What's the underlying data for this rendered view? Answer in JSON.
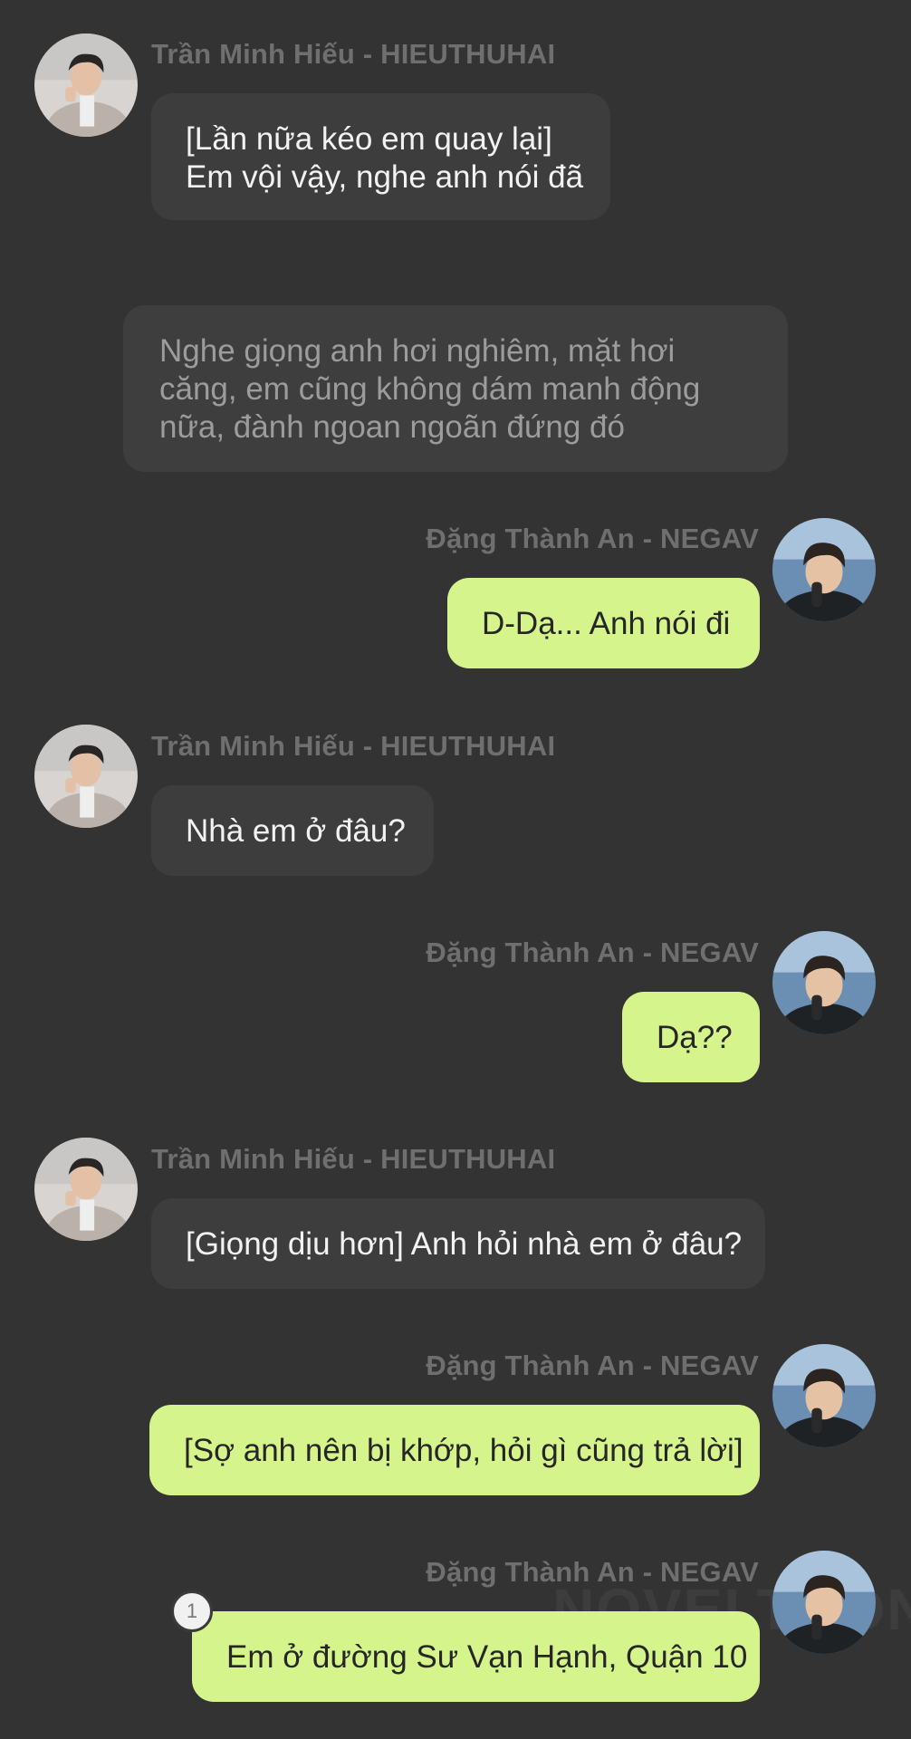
{
  "characters": {
    "left": {
      "name": "Trần Minh Hiếu - HIEUTHUHAI"
    },
    "right": {
      "name": "Đặng Thành An - NEGAV"
    }
  },
  "messages": [
    {
      "side": "left",
      "lines": [
        "[Lần nữa kéo em quay lại]",
        "Em vội vậy, nghe anh nói đã"
      ]
    },
    {
      "side": "narration",
      "lines": [
        "Nghe giọng anh hơi nghiêm, mặt hơi",
        "căng, em cũng không dám manh động",
        "nữa, đành ngoan ngoãn đứng đó"
      ]
    },
    {
      "side": "right",
      "lines": [
        "D-Dạ... Anh nói đi"
      ]
    },
    {
      "side": "left",
      "lines": [
        "Nhà em ở đâu?"
      ]
    },
    {
      "side": "right",
      "lines": [
        "Dạ??"
      ]
    },
    {
      "side": "left",
      "lines": [
        "[Giọng dịu hơn] Anh hỏi nhà em ở đâu?"
      ]
    },
    {
      "side": "right",
      "lines": [
        "[Sợ anh nên bị khớp, hỏi gì cũng trả lời]"
      ]
    },
    {
      "side": "right",
      "lines": [
        "Em ở đường Sư Vạn Hạnh, Quận 10"
      ],
      "badge": "1"
    }
  ],
  "watermark": "NOVELTOON",
  "colors": {
    "background": "#333333",
    "left_bubble": "#3d3d3d",
    "right_bubble": "#d6f48c",
    "name_text": "#6f6f6f"
  }
}
